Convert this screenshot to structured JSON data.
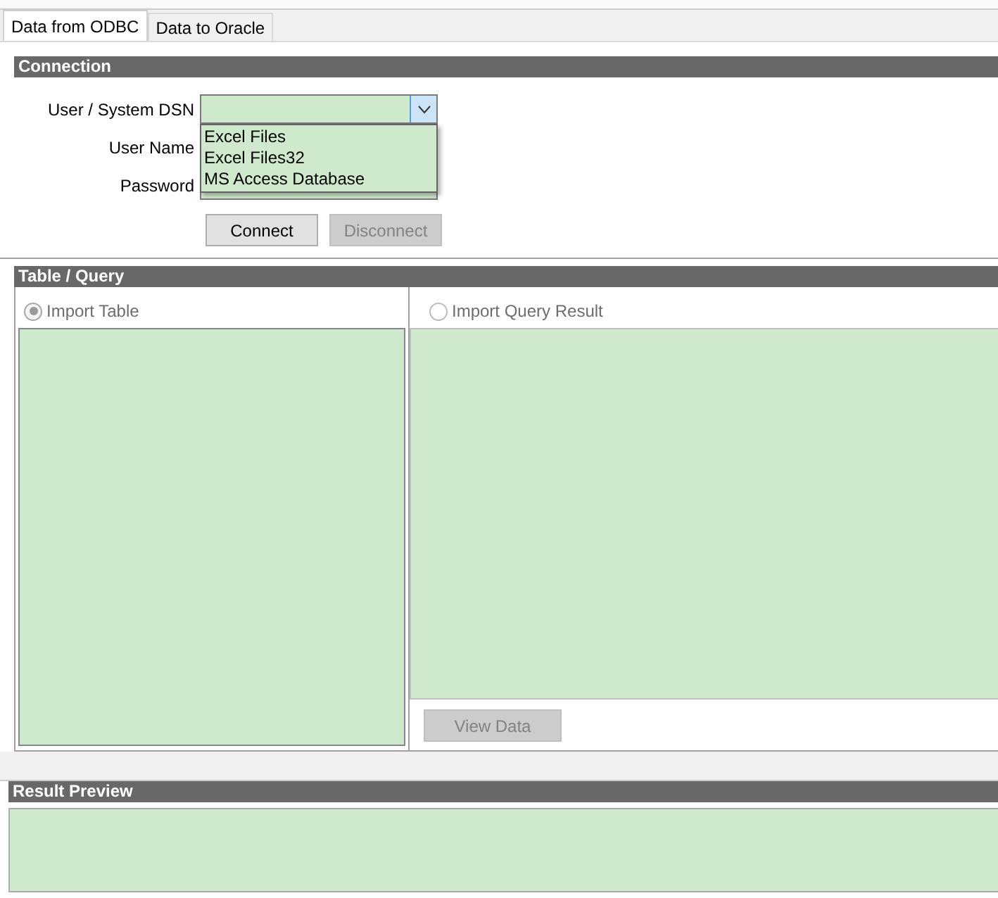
{
  "tabs": [
    {
      "label": "Data from ODBC",
      "selected": true
    },
    {
      "label": "Data to Oracle",
      "selected": false
    }
  ],
  "connection": {
    "title": "Connection",
    "fields": [
      {
        "label": "User / System DSN",
        "kind": "combo",
        "expanded": true,
        "options": [
          "Excel Files",
          "Excel Files32",
          "MS Access Database"
        ]
      },
      {
        "label": "User Name",
        "kind": "text"
      },
      {
        "label": "Password",
        "kind": "password"
      }
    ],
    "buttons": [
      {
        "label": "Connect",
        "disabled": false
      },
      {
        "label": "Disconnect",
        "disabled": true
      }
    ]
  },
  "table_query": {
    "title": "Table / Query",
    "options": [
      {
        "label": "Import Table",
        "selected": true,
        "disabled": true
      },
      {
        "label": "Import Query Result",
        "selected": false,
        "disabled": true
      }
    ],
    "view_button": {
      "label": "View Data",
      "disabled": true
    }
  },
  "result_preview": {
    "title": "Result Preview"
  }
}
